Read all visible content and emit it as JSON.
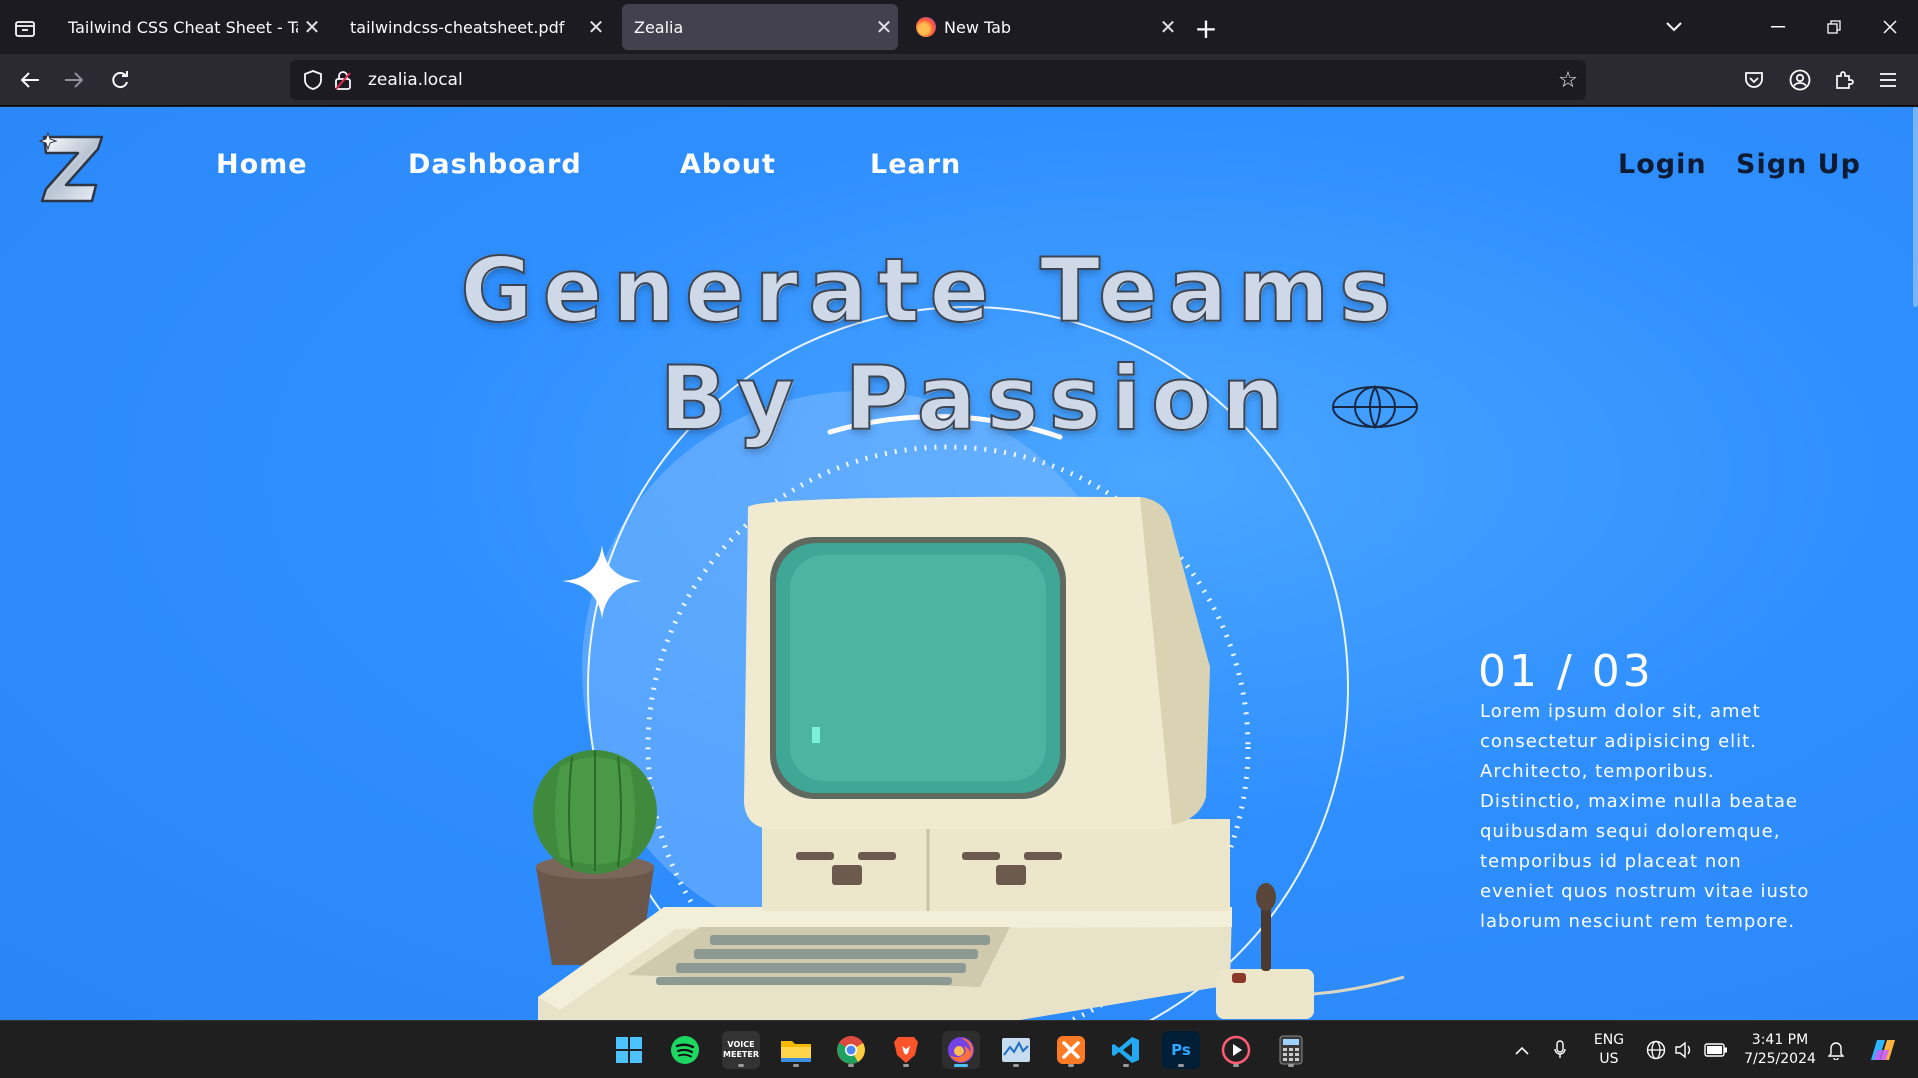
{
  "browser": {
    "tabs": [
      {
        "title": "Tailwind CSS Cheat Sheet - Tailwind",
        "active": false
      },
      {
        "title": "tailwindcss-cheatsheet.pdf",
        "active": false
      },
      {
        "title": "Zealia",
        "active": true
      },
      {
        "title": "New Tab",
        "active": false
      }
    ],
    "url": "zealia.local"
  },
  "site": {
    "nav_left": [
      "Home",
      "Dashboard",
      "About",
      "Learn"
    ],
    "login": "Login",
    "signup": "Sign Up",
    "hero_line1": "Generate Teams",
    "hero_line2": "By Passion",
    "counter": "01 / 03",
    "blurb": "Lorem ipsum dolor sit, amet consectetur adipisicing elit. Architecto, temporibus. Distinctio, maxime nulla beatae quibusdam sequi doloremque, temporibus id placeat non eveniet quos nostrum vitae iusto laborum nesciunt rem tempore."
  },
  "taskbar": {
    "apps": [
      "windows-start",
      "spotify",
      "voicemeeter",
      "file-explorer",
      "chrome",
      "brave",
      "firefox",
      "resource-monitor",
      "xampp",
      "vscode",
      "photoshop",
      "media-player",
      "calculator"
    ],
    "voicemeeter_label": "VOICE MEETER",
    "photoshop_label": "Ps",
    "lang": "ENG",
    "region": "US",
    "time": "3:41 PM",
    "date": "7/25/2024"
  },
  "colors": {
    "page_bg": "#2f8fff",
    "browser_dark": "#1c1b22",
    "toolbar": "#2b2a33",
    "active_tab": "#42414d"
  }
}
